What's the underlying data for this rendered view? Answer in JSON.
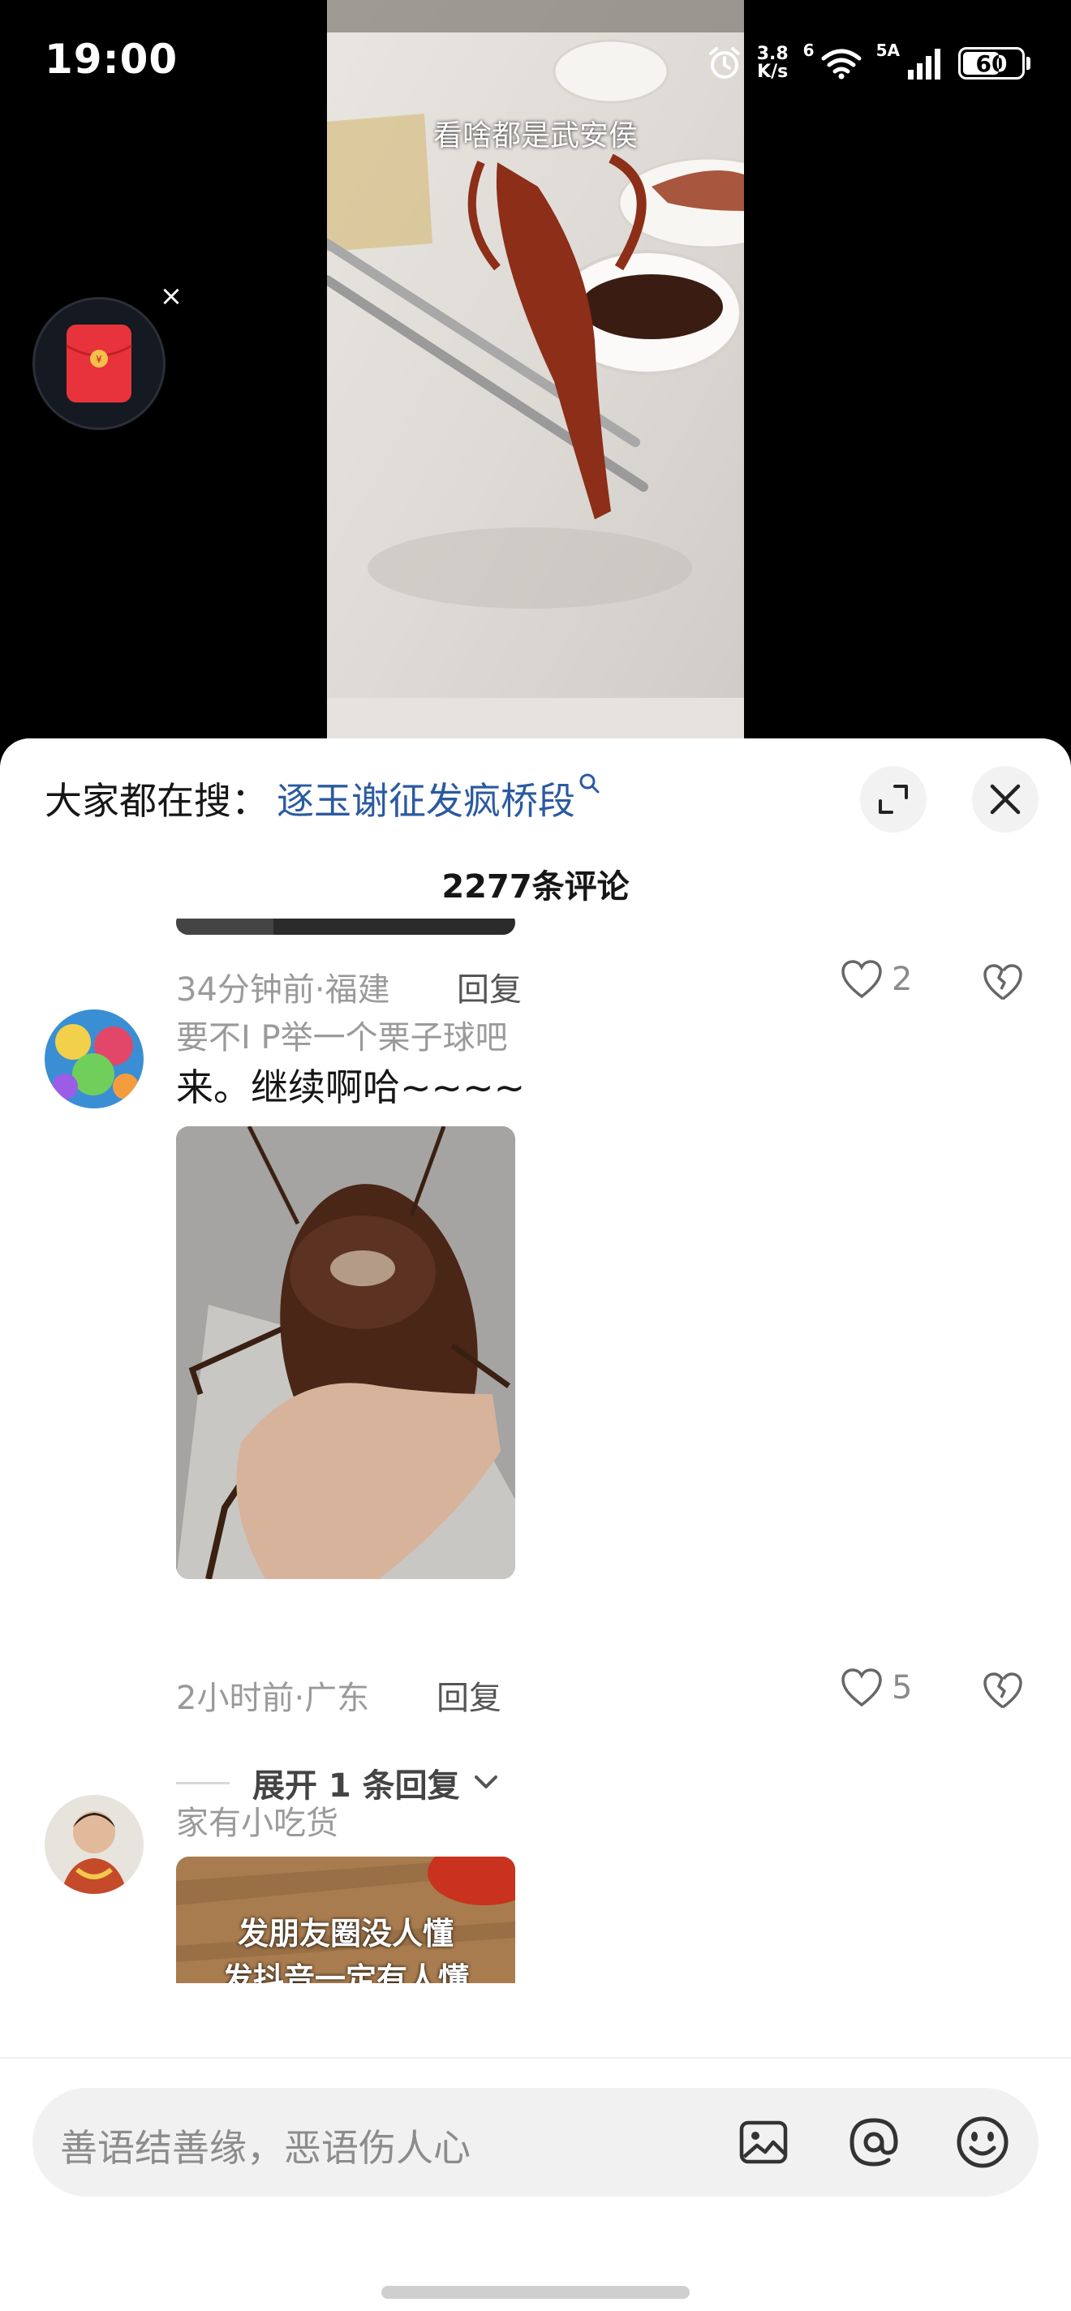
{
  "status_bar": {
    "time": "19:00",
    "net_speed_value": "3.8",
    "net_speed_unit": "K/s",
    "wifi_label": "6",
    "signal_label": "5A",
    "battery": "60"
  },
  "video": {
    "caption": "看啥都是武安侯"
  },
  "sheet": {
    "search_prefix": "大家都在搜：",
    "search_term": "逐玉谢征发疯桥段",
    "comments_count": "2277条评论"
  },
  "comments": [
    {
      "time_location": "34分钟前·福建",
      "reply_label": "回复",
      "likes": "2"
    },
    {
      "username": "要不I P举一个栗子球吧",
      "text": "来。继续啊哈~~~~",
      "time_location": "2小时前·广东",
      "reply_label": "回复",
      "likes": "5",
      "expand_label": "展开 1 条回复"
    },
    {
      "username": "家有小吃货",
      "image_text_line1": "发朋友圈没人懂",
      "image_text_line2": "发抖音一定有人懂"
    }
  ],
  "input": {
    "placeholder": "善语结善缘，恶语伤人心"
  },
  "colors": {
    "link": "#2b5aa0",
    "meta_gray": "#9a9a9a",
    "sheet_bg": "#ffffff",
    "red_packet": "#e8333c"
  }
}
